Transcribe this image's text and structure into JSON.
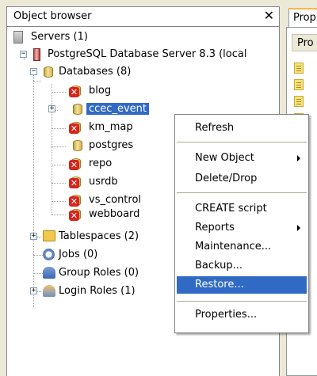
{
  "object_browser": {
    "title": "Object browser",
    "close_glyph": "✕"
  },
  "tree": {
    "servers_label": "Servers (1)",
    "server_label": "PostgreSQL Database Server 8.3 (local",
    "databases_label": "Databases (8)",
    "databases": [
      "blog",
      "ccec_event",
      "km_map",
      "postgres",
      "repo",
      "usrdb",
      "vs_control",
      "webboard"
    ],
    "selected_database": "ccec_event",
    "tablespaces_label": "Tablespaces (2)",
    "jobs_label": "Jobs (0)",
    "group_roles_label": "Group Roles (0)",
    "login_roles_label": "Login Roles (1)"
  },
  "properties_panel": {
    "tab_label": "Prop",
    "column_label": "Pro"
  },
  "context_menu": {
    "items": [
      {
        "label": "Refresh"
      },
      {
        "label": "New Object"
      },
      {
        "label": "Delete/Drop"
      },
      {
        "label": "CREATE script"
      },
      {
        "label": "Reports"
      },
      {
        "label": "Maintenance..."
      },
      {
        "label": "Backup..."
      },
      {
        "label": "Restore..."
      },
      {
        "label": "Properties..."
      }
    ],
    "highlighted": "Restore..."
  },
  "colors": {
    "selection": "#316ac5",
    "danger_badge": "#d8231b",
    "db_gold": "#d8b24c"
  }
}
